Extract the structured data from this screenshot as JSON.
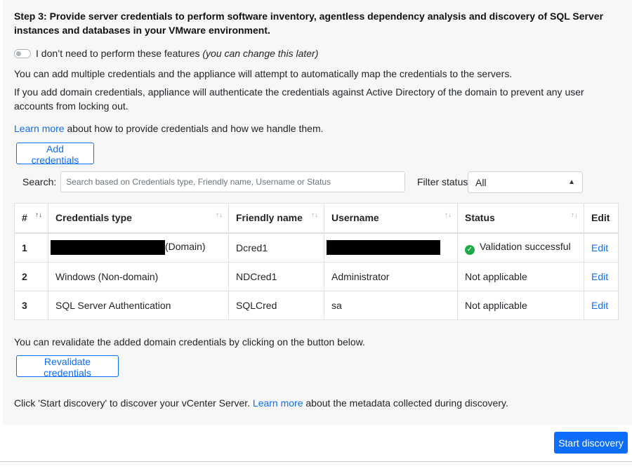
{
  "step": {
    "heading": "Step 3: Provide server credentials to perform software inventory, agentless dependency analysis and discovery of SQL Server instances and databases in your VMware environment."
  },
  "toggle": {
    "label": "I don’t need to perform these features",
    "hint": "(you can change this later)"
  },
  "info": {
    "line1": "You can add multiple credentials and the appliance will attempt to automatically map the credentials to the servers.",
    "line2": "If you add domain credentials, appliance will authenticate the credentials against Active Directory of the domain to prevent any user accounts from locking out.",
    "learn_more_link": "Learn more",
    "learn_more_rest": " about how to provide credentials and how we handle them."
  },
  "add_button": "Add credentials",
  "search": {
    "label": "Search:",
    "placeholder": "Search based on Credentials type, Friendly name, Username or Status"
  },
  "filter": {
    "label": "Filter status",
    "value": "All"
  },
  "table": {
    "headers": [
      "#",
      "Credentials type",
      "Friendly name",
      "Username",
      "Status",
      "Edit"
    ],
    "rows": [
      {
        "num": "1",
        "type": "(Domain)",
        "friendly": "Dcred1",
        "username": "",
        "status": "Validation successful",
        "edit": "Edit"
      },
      {
        "num": "2",
        "type": "Windows (Non-domain)",
        "friendly": "NDCred1",
        "username": "Administrator",
        "status": "Not applicable",
        "edit": "Edit"
      },
      {
        "num": "3",
        "type": "SQL Server Authentication",
        "friendly": "SQLCred",
        "username": "sa",
        "status": "Not applicable",
        "edit": "Edit"
      }
    ]
  },
  "revalidate": {
    "text": "You can revalidate the added domain credentials by clicking on the button below.",
    "button": "Revalidate credentials"
  },
  "discovery": {
    "text_before": "Click 'Start discovery' to discover your vCenter Server. ",
    "link": "Learn more",
    "text_after": " about the metadata collected during discovery.",
    "button": "Start discovery"
  },
  "colors": {
    "accent": "#0d6efd",
    "success": "#20a94a",
    "panel_bg": "#f7f7f7"
  }
}
